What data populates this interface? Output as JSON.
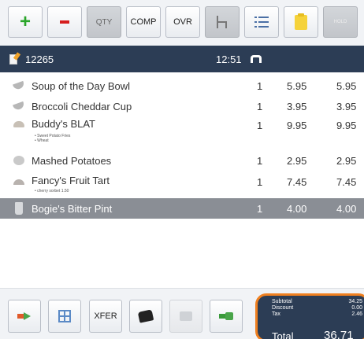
{
  "toolbar": {
    "qty_label": "QTY",
    "comp_label": "COMP",
    "ovr_label": "OVR",
    "hold_label": "HOLD",
    "icons": [
      "plus-icon",
      "minus-icon",
      "seat-chair-icon",
      "list-icon",
      "note-icon"
    ]
  },
  "order": {
    "number": "12265",
    "time": "12:51"
  },
  "items": [
    {
      "name": "Soup of the Day Bowl",
      "qty": "1",
      "price": "5.95",
      "total": "5.95",
      "mods": [],
      "icon": "bowl-icon"
    },
    {
      "name": "Broccoli Cheddar Cup",
      "qty": "1",
      "price": "3.95",
      "total": "3.95",
      "mods": [],
      "icon": "bowl-icon"
    },
    {
      "name": "Buddy's BLAT",
      "qty": "1",
      "price": "9.95",
      "total": "9.95",
      "mods": [
        "• Sweet Potato Fries",
        "• Wheat"
      ],
      "icon": "sandwich-icon"
    },
    {
      "name": "Mashed Potatoes",
      "qty": "1",
      "price": "2.95",
      "total": "2.95",
      "mods": [],
      "icon": "potato-icon"
    },
    {
      "name": "Fancy's Fruit Tart",
      "qty": "1",
      "price": "7.45",
      "total": "7.45",
      "mods": [
        "• cherry sorbet 1.50"
      ],
      "icon": "tart-icon"
    },
    {
      "name": "Bogie's Bitter Pint",
      "qty": "1",
      "price": "4.00",
      "total": "4.00",
      "mods": [],
      "icon": "pint-icon",
      "selected": true
    }
  ],
  "bottom": {
    "xfer_label": "XFER",
    "icons": [
      "transfer-arrow-icon",
      "split-check-icon",
      "printer-icon",
      "receipt-icon",
      "cash-payment-icon"
    ]
  },
  "totals": {
    "subtotal_label": "Subtotal",
    "discount_label": "Discount",
    "tax_label": "Tax",
    "subtotal_value": "34.25",
    "discount_value": "0.00",
    "tax_value": "2.46",
    "total_label": "Total",
    "total_value": "36.71"
  },
  "colors": {
    "header_bg": "#2c3d55",
    "selected_row": "#8a8e95",
    "totals_outline": "#f08020",
    "plus": "#2aa52a",
    "minus": "#d61e1e"
  }
}
